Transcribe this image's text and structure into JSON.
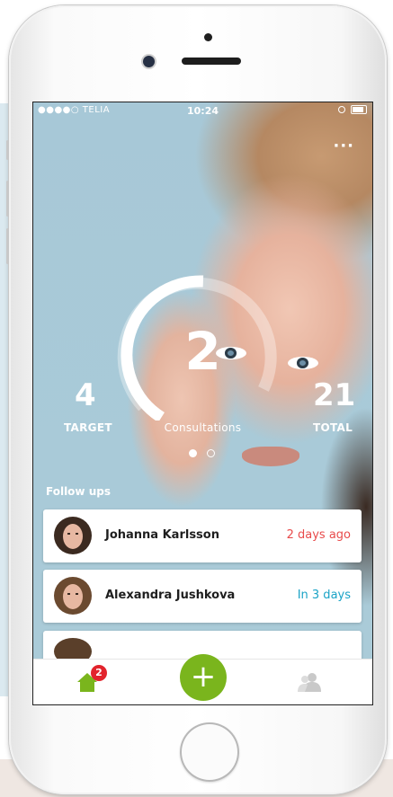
{
  "status_bar": {
    "carrier": "●●●●○ TELIA",
    "time": "10:24"
  },
  "menu": {
    "more_icon": "···"
  },
  "gauge": {
    "value": "2",
    "label": "Consultations",
    "progress": 0.5
  },
  "stats": {
    "target": {
      "value": "4",
      "label": "TARGET"
    },
    "total": {
      "value": "21",
      "label": "TOTAL"
    }
  },
  "pager": {
    "pages": 2,
    "active": 1
  },
  "follow_ups": {
    "title": "Follow ups",
    "items": [
      {
        "name": "Johanna Karlsson",
        "due": "2 days ago",
        "due_color": "#e84b4b"
      },
      {
        "name": "Alexandra Jushkova",
        "due": "In 3 days",
        "due_color": "#1aa3c6"
      }
    ]
  },
  "tabbar": {
    "home_badge": "2",
    "add_label": "+",
    "accent": "#7ab51d",
    "icons": [
      "home-icon",
      "plus-icon",
      "people-icon"
    ]
  }
}
